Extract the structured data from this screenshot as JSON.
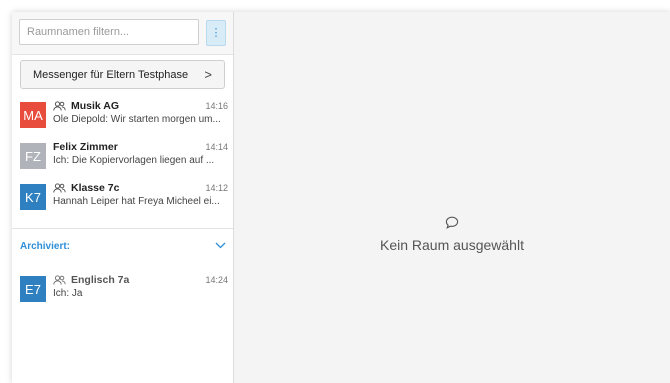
{
  "filter": {
    "placeholder": "Raumnamen filtern...",
    "menu_icon": "kebab-icon"
  },
  "messenger_button": {
    "label": "Messenger für Eltern Testphase",
    "chevron": ">"
  },
  "rooms": [
    {
      "initials": "MA",
      "color": "#e74c3c",
      "is_group": true,
      "title": "Musik AG",
      "time": "14:16",
      "preview": "Ole Diepold: Wir starten morgen um..."
    },
    {
      "initials": "FZ",
      "color": "#b0b4ba",
      "is_group": false,
      "title": "Felix Zimmer",
      "time": "14:14",
      "preview": "Ich: Die Kopiervorlagen liegen auf ..."
    },
    {
      "initials": "K7",
      "color": "#2f80c1",
      "is_group": true,
      "title": "Klasse 7c",
      "time": "14:12",
      "preview": "Hannah Leiper hat Freya Micheel ei..."
    }
  ],
  "archived": {
    "label": "Archiviert:",
    "rooms": [
      {
        "initials": "E7",
        "color": "#2f80c1",
        "is_group": true,
        "title": "Englisch 7a",
        "time": "14:24",
        "preview": "Ich: Ja"
      }
    ]
  },
  "main": {
    "empty_icon": "chat-bubble-icon",
    "empty_text": "Kein Raum ausgewählt"
  }
}
